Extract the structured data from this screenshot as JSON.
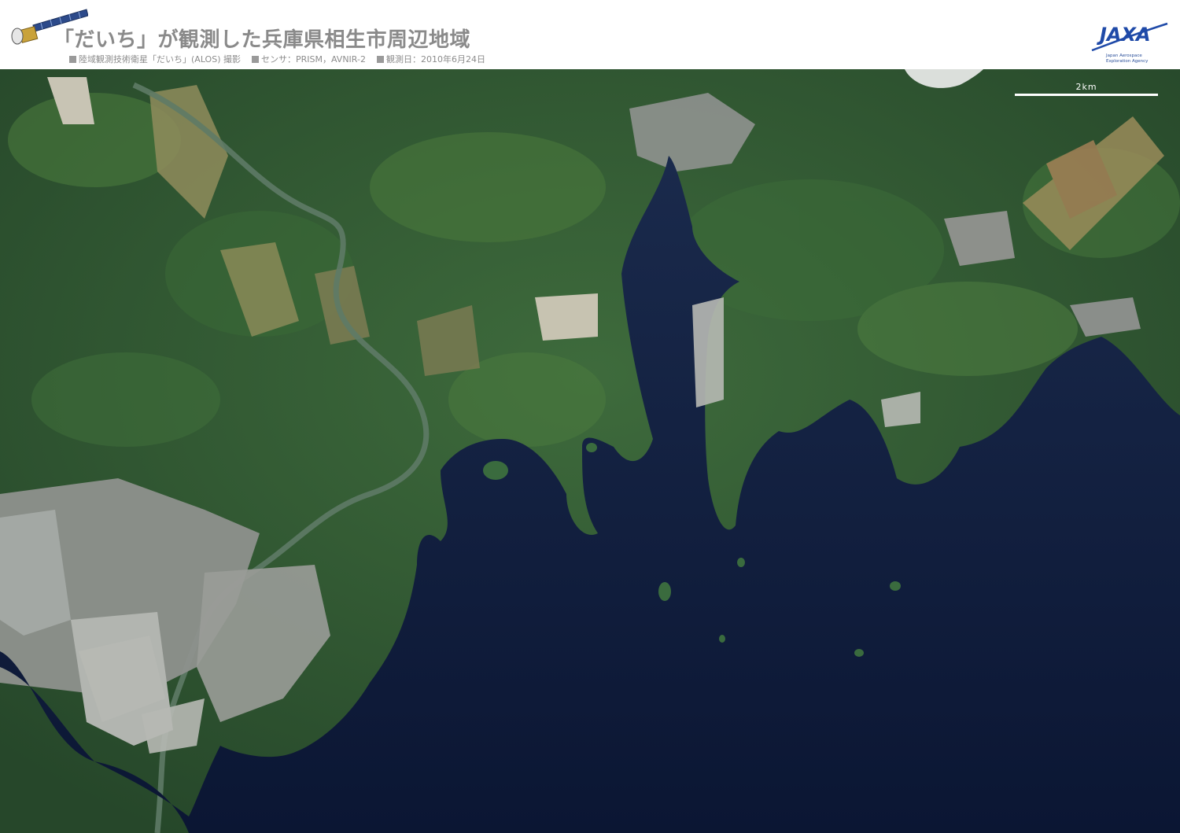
{
  "header": {
    "title": "「だいち」が観測した兵庫県相生市周辺地域",
    "subline": [
      {
        "label": "陸域観測技術衛星「だいち」(ALOS) 撮影"
      },
      {
        "label": "センサ：PRISM，AVNIR-2"
      },
      {
        "label": "観測日：2010年6月24日"
      }
    ]
  },
  "logo": {
    "wordmark": "JAXA",
    "line1": "Japan Aerospace",
    "line2": "Exploration Agency"
  },
  "map": {
    "scale_label": "2km",
    "colors": {
      "sea": "#0d1b3e",
      "forest": "#2f5a34",
      "forest_light": "#4d7a3c",
      "urban": "#8c8f8c",
      "farmland": "#8a8a5a"
    }
  }
}
